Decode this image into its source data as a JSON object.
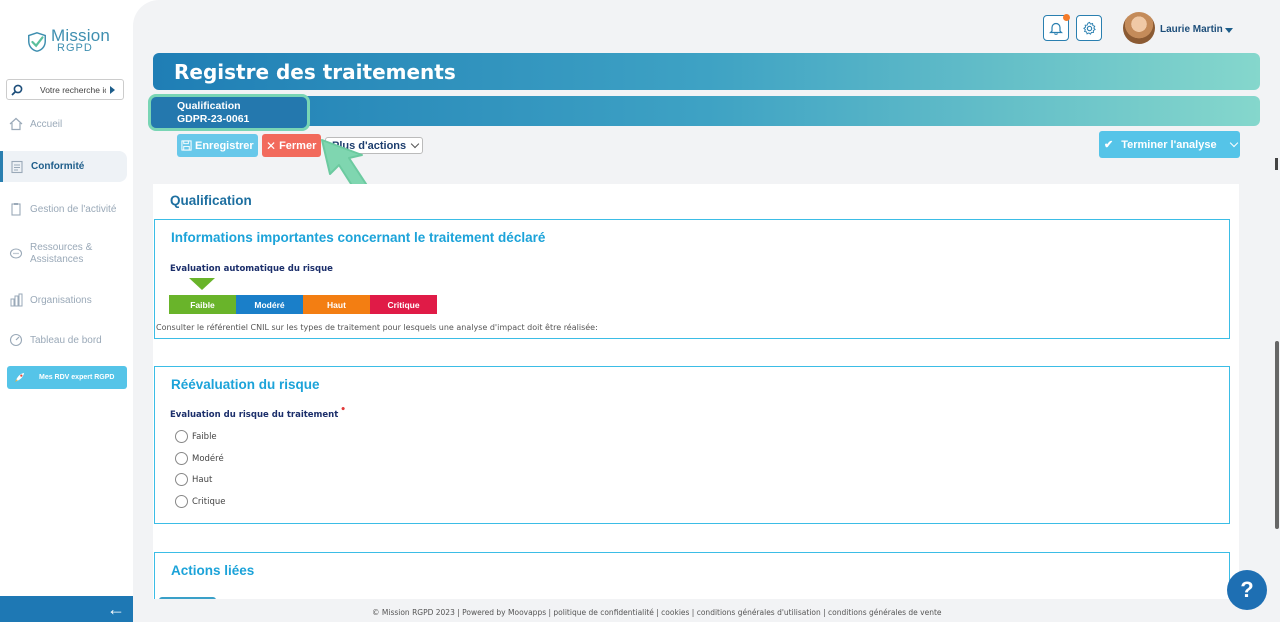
{
  "app": {
    "logo_line1": "Mission",
    "logo_line2": "RGPD"
  },
  "sidebar": {
    "search_placeholder": "Votre recherche ic",
    "items": [
      {
        "label": "Accueil",
        "icon": "home-icon"
      },
      {
        "label": "Conformité",
        "icon": "document-icon",
        "active": true
      },
      {
        "label": "Gestion de l'activité",
        "icon": "clipboard-icon"
      },
      {
        "label": "Ressources & Assistances",
        "icon": "chat-icon"
      },
      {
        "label": "Organisations",
        "icon": "building-icon"
      },
      {
        "label": "Tableau de bord",
        "icon": "dashboard-icon"
      }
    ],
    "rdv_label": "Mes RDV expert RGPD",
    "back_label": "←"
  },
  "header": {
    "user_name": "Laurie Martin"
  },
  "page": {
    "title": "Registre des traitements",
    "record_type": "Qualification",
    "record_id": "GDPR-23-0061"
  },
  "toolbar": {
    "save_label": "Enregistrer",
    "close_label": "Fermer",
    "more_label": "Plus d'actions",
    "finish_label": "Terminer l'analyse"
  },
  "content": {
    "section_title": "Qualification",
    "card1": {
      "title": "Informations importantes concernant le traitement déclaré",
      "auto_risk_label": "Evaluation automatique du risque",
      "risk_levels": [
        {
          "label": "Faible",
          "color": "#69b42a"
        },
        {
          "label": "Modéré",
          "color": "#1a7fc9"
        },
        {
          "label": "Haut",
          "color": "#f37e12"
        },
        {
          "label": "Critique",
          "color": "#e01b47"
        }
      ],
      "selected_level": "Faible",
      "cnil_note": "Consulter le référentiel CNIL sur les types de traitement pour lesquels une analyse d'impact doit être réalisée:"
    },
    "card2": {
      "title": "Réévaluation du risque",
      "field_label": "Evaluation du risque du traitement",
      "required_marker": "•",
      "options": [
        "Faible",
        "Modéré",
        "Haut",
        "Critique"
      ]
    },
    "card3": {
      "title": "Actions liées"
    }
  },
  "help_label": "?",
  "footer": "© Mission RGPD 2023 | Powered by Moovapps | politique de confidentialité | cookies | conditions générales d'utilisation | conditions générales de vente"
}
